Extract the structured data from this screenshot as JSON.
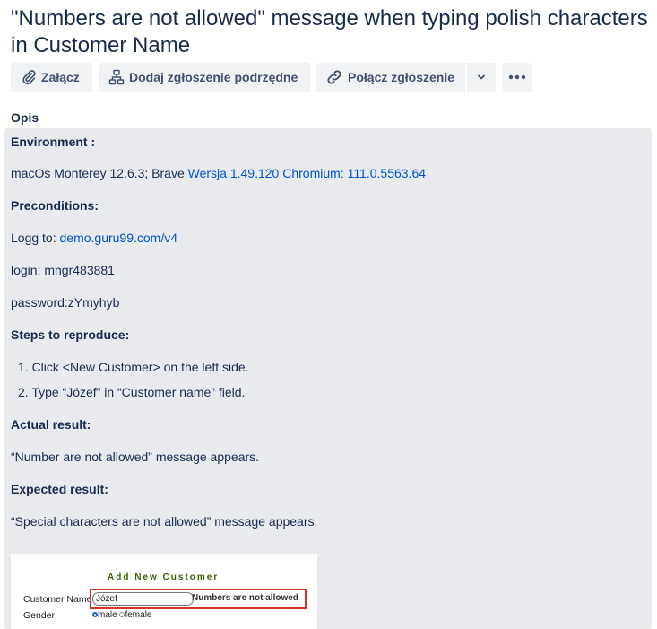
{
  "issue": {
    "title": "\"Numbers are not allowed\" message when typing polish characters in Customer Name"
  },
  "toolbar": {
    "attach_label": "Załącz",
    "child_label": "Dodaj zgłoszenie podrzędne",
    "link_label": "Połącz zgłoszenie",
    "dropdown_icon": "chevron-down-icon",
    "more_icon": "more-icon"
  },
  "description": {
    "label": "Opis",
    "environment_heading": "Environment :",
    "environment_text": "macOs Monterey 12.6.3; Brave ",
    "environment_link": "Wersja 1.49.120 Chromium: 111.0.5563.64",
    "preconditions_heading": "Preconditions:",
    "logg_text": "Logg to: ",
    "logg_link": "demo.guru99.com/v4",
    "login": "login: mngr483881",
    "password": "password:zYmyhyb",
    "steps_heading": "Steps to reproduce:",
    "steps": [
      "1. Click <New Customer> on the left side.",
      "2. Type “Józef” in “Customer name” field."
    ],
    "actual_heading": "Actual result:",
    "actual_text": " “Number are not allowed”  message appears.",
    "expected_heading": "Expected result:",
    "expected_text": "“Special characters are not allowed” message appears."
  },
  "screenshot": {
    "title": "Add New Customer",
    "customer_name_label": "Customer Name",
    "customer_name_value": "Józef",
    "error_message": "Numbers are not allowed",
    "gender_label": "Gender",
    "gender_male": "male",
    "gender_female": "female"
  },
  "colors": {
    "link": "#0052cc",
    "panel_bg": "#e9eaee",
    "button_bg": "#f1f2f4",
    "highlight_box": "#d9322b"
  }
}
